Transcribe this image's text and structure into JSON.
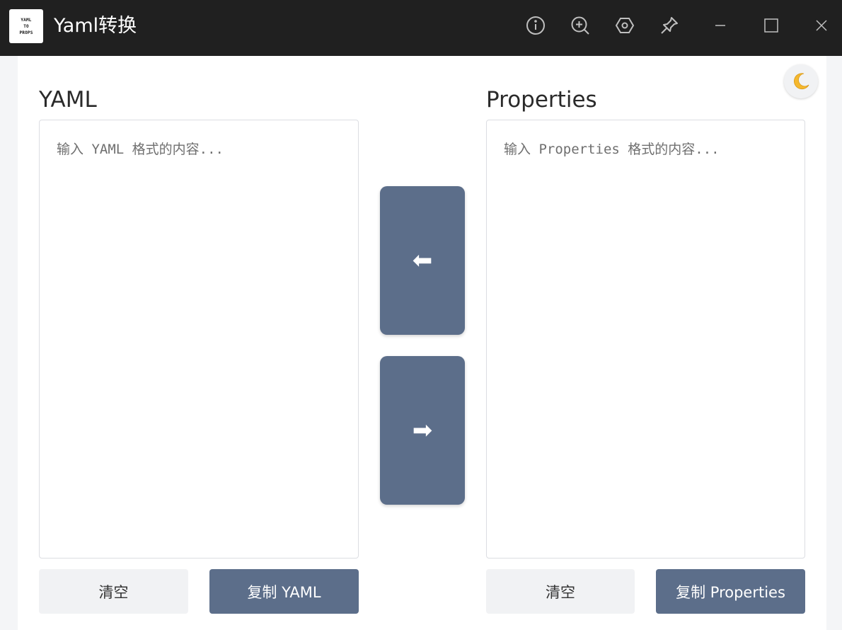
{
  "window": {
    "title": "Yaml转换",
    "logo_lines": [
      "YAML",
      "TO",
      "PROPS"
    ],
    "controls": {
      "info_icon": "info-icon",
      "zoom_icon": "zoom-in-icon",
      "settings_icon": "settings-hexagon-icon",
      "pin_icon": "pin-icon",
      "minimize_icon": "minimize-icon",
      "maximize_icon": "maximize-icon",
      "close_icon": "close-icon"
    }
  },
  "theme_toggle": {
    "icon": "moon-icon",
    "glyph": "🌙"
  },
  "yaml_pane": {
    "title": "YAML",
    "placeholder": "输入 YAML 格式的内容...",
    "value": "",
    "clear_label": "清空",
    "copy_label": "复制 YAML"
  },
  "props_pane": {
    "title": "Properties",
    "placeholder": "输入 Properties 格式的内容...",
    "value": "",
    "clear_label": "清空",
    "copy_label": "复制 Properties"
  },
  "convert": {
    "to_yaml_glyph": "⬅",
    "to_props_glyph": "➡"
  },
  "colors": {
    "titlebar": "#202020",
    "accent": "#5c6e8a",
    "light_button": "#f1f2f4",
    "background": "#f4f5f7"
  }
}
